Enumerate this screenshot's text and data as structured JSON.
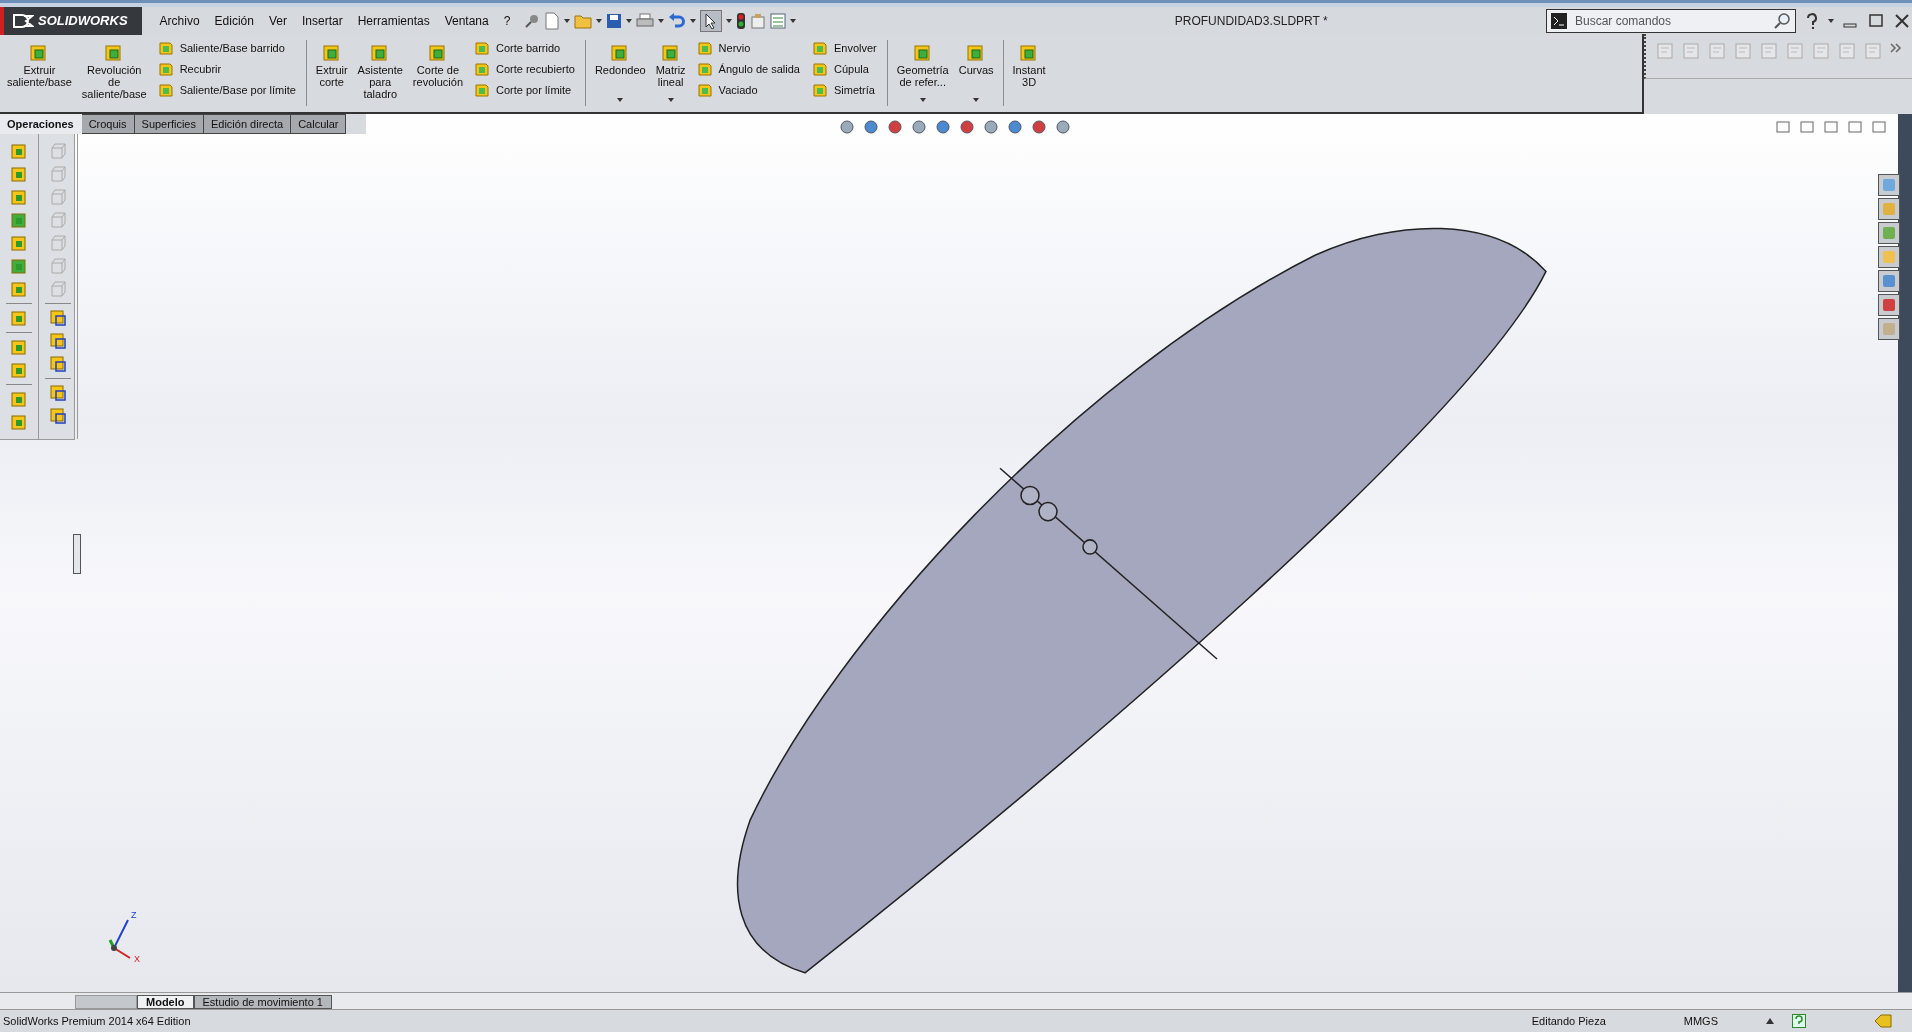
{
  "title_bar": {
    "logo": "SOLIDWORKS",
    "menus": [
      "Archivo",
      "Edición",
      "Ver",
      "Insertar",
      "Herramientas",
      "Ventana",
      "?"
    ],
    "document_title": "PROFUNDIDAD3.SLDPRT *",
    "search": {
      "placeholder": "Buscar comandos"
    }
  },
  "ribbon": {
    "groups": [
      {
        "items": [
          {
            "kind": "big",
            "lines": [
              "Extruir",
              "saliente/base"
            ],
            "dropdown": false
          },
          {
            "kind": "big",
            "lines": [
              "Revolución",
              "de",
              "saliente/base"
            ],
            "dropdown": false
          },
          {
            "kind": "list",
            "entries": [
              "Saliente/Base barrido",
              "Recubrir",
              "Saliente/Base por límite"
            ]
          }
        ]
      },
      {
        "items": [
          {
            "kind": "big",
            "lines": [
              "Extruir",
              "corte"
            ],
            "dropdown": false
          },
          {
            "kind": "big",
            "lines": [
              "Asistente",
              "para",
              "taladro"
            ],
            "dropdown": false
          },
          {
            "kind": "big",
            "lines": [
              "Corte de",
              "revolución"
            ],
            "dropdown": false
          },
          {
            "kind": "list",
            "entries": [
              "Corte barrido",
              "Corte recubierto",
              "Corte por límite"
            ]
          }
        ]
      },
      {
        "items": [
          {
            "kind": "big",
            "lines": [
              "Redondeo"
            ],
            "dropdown": true
          },
          {
            "kind": "big",
            "lines": [
              "Matriz",
              "lineal"
            ],
            "dropdown": true
          },
          {
            "kind": "list",
            "entries": [
              "Nervio",
              "Ángulo de salida",
              "Vaciado"
            ]
          },
          {
            "kind": "list",
            "entries": [
              "Envolver",
              "Cúpula",
              "Simetría"
            ]
          }
        ]
      },
      {
        "items": [
          {
            "kind": "big",
            "lines": [
              "Geometría",
              "de refer..."
            ],
            "dropdown": true
          },
          {
            "kind": "big",
            "lines": [
              "Curvas"
            ],
            "dropdown": true
          }
        ]
      },
      {
        "items": [
          {
            "kind": "big",
            "lines": [
              "Instant",
              "3D"
            ],
            "dropdown": false
          }
        ]
      }
    ]
  },
  "tabs": [
    {
      "label": "Operaciones",
      "selected": true
    },
    {
      "label": "Croquis",
      "selected": false
    },
    {
      "label": "Superficies",
      "selected": false
    },
    {
      "label": "Edición directa",
      "selected": false
    },
    {
      "label": "Calcular",
      "selected": false
    }
  ],
  "triad": {
    "labels": [
      "Z",
      "X"
    ]
  },
  "bottom_tabs": [
    {
      "label": "Modelo",
      "selected": true
    },
    {
      "label": "Estudio de movimiento 1",
      "selected": false
    }
  ],
  "status_bar": {
    "edition": "SolidWorks Premium 2014 x64 Edition",
    "mode": "Editando Pieza",
    "units": "MMGS"
  }
}
